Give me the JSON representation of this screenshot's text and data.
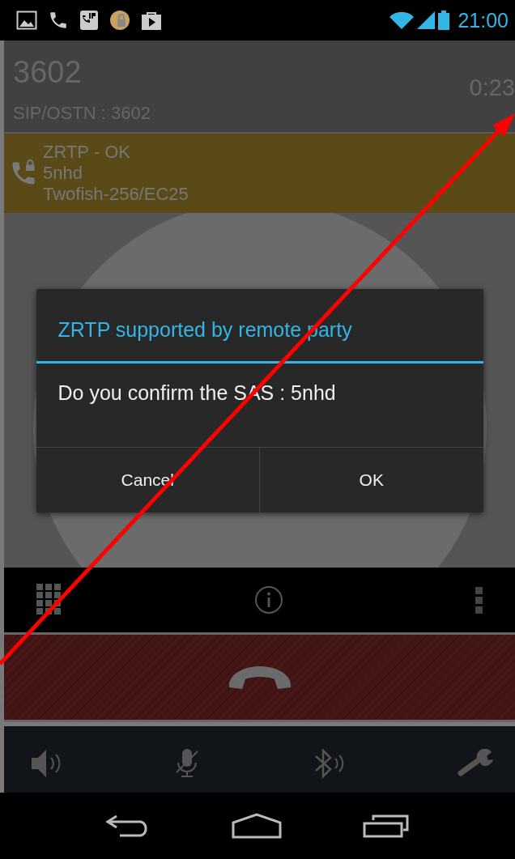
{
  "status_bar": {
    "time": "21:00"
  },
  "call": {
    "number": "3602",
    "duration": "0:23",
    "account": "SIP/OSTN : 3602"
  },
  "zrtp": {
    "status": "ZRTP - OK",
    "sas": "5nhd",
    "cipher": "Twofish-256/EC25"
  },
  "dialog": {
    "title": "ZRTP supported by remote party",
    "message": "Do you confirm the SAS : 5nhd",
    "buttons": [
      "Cancel",
      "OK"
    ]
  }
}
